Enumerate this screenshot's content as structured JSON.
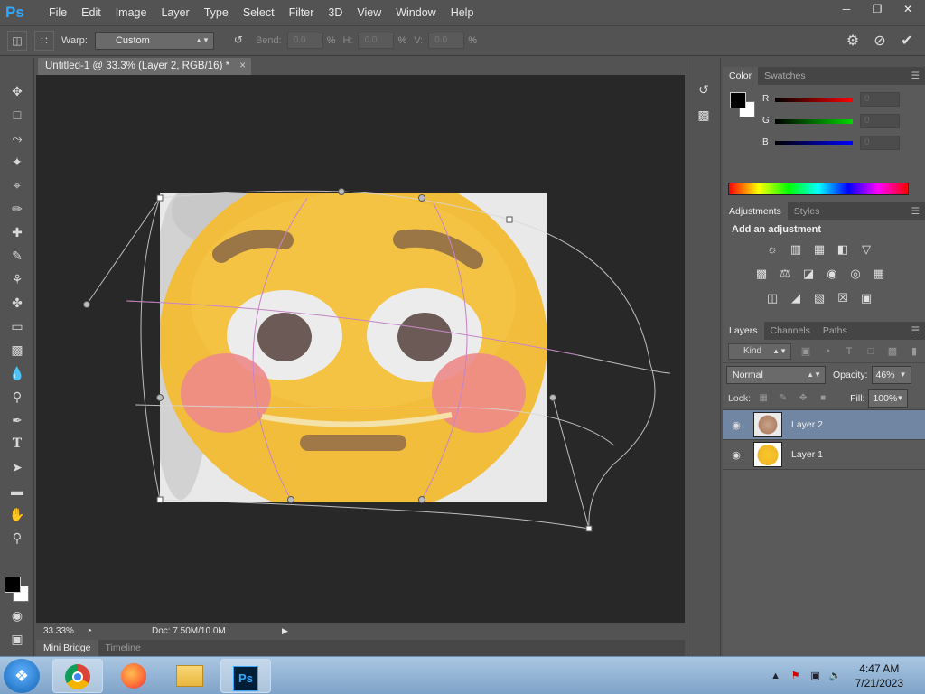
{
  "app": {
    "logo": "Ps",
    "menu": [
      "File",
      "Edit",
      "Image",
      "Layer",
      "Type",
      "Select",
      "Filter",
      "3D",
      "View",
      "Window",
      "Help"
    ],
    "window_controls": [
      "minimize-icon",
      "restore-icon",
      "close-icon"
    ]
  },
  "options": {
    "warp_label": "Warp:",
    "warp_value": "Custom",
    "bend_label": "Bend:",
    "bend_value": "0.0",
    "h_label": "H:",
    "h_value": "0.0",
    "v_label": "V:",
    "v_value": "0.0",
    "pct": "%",
    "commit_icons": [
      "puppet-warp-icon",
      "cancel-icon",
      "commit-check-icon"
    ]
  },
  "document": {
    "tab_title": "Untitled-1 @ 33.3% (Layer 2, RGB/16) *",
    "tab_close": "×",
    "zoom": "33.33%",
    "doc_info": "Doc: 7.50M/10.0M"
  },
  "bottom_tabs": [
    "Mini Bridge",
    "Timeline"
  ],
  "color_panel": {
    "tabs": [
      "Color",
      "Swatches"
    ],
    "rows": [
      {
        "label": "R",
        "value": "0",
        "color": "#ff0000"
      },
      {
        "label": "G",
        "value": "0",
        "color": "#00d800"
      },
      {
        "label": "B",
        "value": "0",
        "color": "#0000ff"
      }
    ]
  },
  "adjustments": {
    "tabs": [
      "Adjustments",
      "Styles"
    ],
    "title": "Add an adjustment"
  },
  "layers": {
    "tabs": [
      "Layers",
      "Channels",
      "Paths"
    ],
    "kind": "Kind",
    "blend_mode": "Normal",
    "opacity_label": "Opacity:",
    "opacity_value": "46%",
    "lock_label": "Lock:",
    "fill_label": "Fill:",
    "fill_value": "100%",
    "items": [
      {
        "name": "Layer 2",
        "selected": true
      },
      {
        "name": "Layer 1",
        "selected": false
      }
    ]
  },
  "taskbar": {
    "clock_time": "4:47 AM",
    "clock_date": "7/21/2023",
    "apps": [
      "chrome-icon",
      "firefox-icon",
      "explorer-icon",
      "photoshop-icon"
    ]
  },
  "colors": {
    "accent": "#31a8ff",
    "canvas_bg": "#282828",
    "selected_layer": "#7086a3"
  }
}
